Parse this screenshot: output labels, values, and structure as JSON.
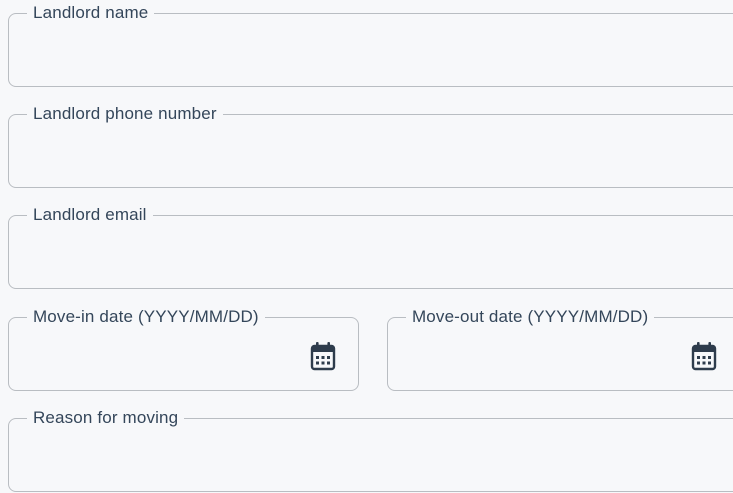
{
  "form": {
    "landlord_name": {
      "label": "Landlord name",
      "value": ""
    },
    "landlord_phone": {
      "label": "Landlord phone number",
      "value": ""
    },
    "landlord_email": {
      "label": "Landlord email",
      "value": ""
    },
    "move_in": {
      "label": "Move-in date (YYYY/MM/DD)",
      "value": "",
      "icon": "calendar-icon"
    },
    "move_out": {
      "label": "Move-out date (YYYY/MM/DD)",
      "value": "",
      "icon": "calendar-icon"
    },
    "reason": {
      "label": "Reason for moving",
      "value": ""
    }
  },
  "colors": {
    "background": "#f7f8fa",
    "border": "#b9bdc2",
    "label": "#34465a",
    "icon": "#2e3c4c"
  }
}
